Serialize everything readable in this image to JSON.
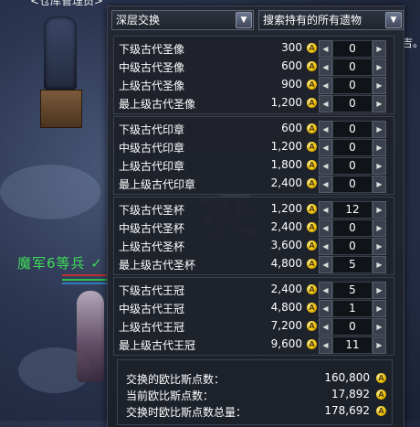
{
  "scene": {
    "npc_label": "<仓库管理员>",
    "enemy_label": "魔军6等兵 ✓",
    "right_edge_text": "吉。"
  },
  "panel": {
    "category_select": "深层交换",
    "filter_select": "搜索持有的所有遗物",
    "groups": [
      {
        "items": [
          {
            "name": "下级古代圣像",
            "price": "300",
            "qty": "0"
          },
          {
            "name": "中级古代圣像",
            "price": "600",
            "qty": "0"
          },
          {
            "name": "上级古代圣像",
            "price": "900",
            "qty": "0"
          },
          {
            "name": "最上级古代圣像",
            "price": "1,200",
            "qty": "0"
          }
        ]
      },
      {
        "items": [
          {
            "name": "下级古代印章",
            "price": "600",
            "qty": "0"
          },
          {
            "name": "中级古代印章",
            "price": "1,200",
            "qty": "0"
          },
          {
            "name": "上级古代印章",
            "price": "1,800",
            "qty": "0"
          },
          {
            "name": "最上级古代印章",
            "price": "2,400",
            "qty": "0"
          }
        ]
      },
      {
        "items": [
          {
            "name": "下级古代圣杯",
            "price": "1,200",
            "qty": "12"
          },
          {
            "name": "中级古代圣杯",
            "price": "2,400",
            "qty": "0"
          },
          {
            "name": "上级古代圣杯",
            "price": "3,600",
            "qty": "0"
          },
          {
            "name": "最上级古代圣杯",
            "price": "4,800",
            "qty": "5"
          }
        ]
      },
      {
        "items": [
          {
            "name": "下级古代王冠",
            "price": "2,400",
            "qty": "5"
          },
          {
            "name": "中级古代王冠",
            "price": "4,800",
            "qty": "1"
          },
          {
            "name": "上级古代王冠",
            "price": "7,200",
            "qty": "0"
          },
          {
            "name": "最上级古代王冠",
            "price": "9,600",
            "qty": "11"
          }
        ]
      }
    ],
    "summary": {
      "exchanged_label": "交换的欧比斯点数：",
      "exchanged_value": "160,800",
      "current_label": "当前欧比斯点数：",
      "current_value": "17,892",
      "total_label": "交换时欧比斯点数总量：",
      "total_value": "178,692"
    },
    "icons": {
      "coin": "coin-icon",
      "minus": "left-arrow-icon",
      "plus": "right-arrow-icon",
      "dropdown": "chevron-down-icon"
    },
    "colors": {
      "enemy_name": "#3fdc5a",
      "coin": "#e5b800"
    }
  }
}
